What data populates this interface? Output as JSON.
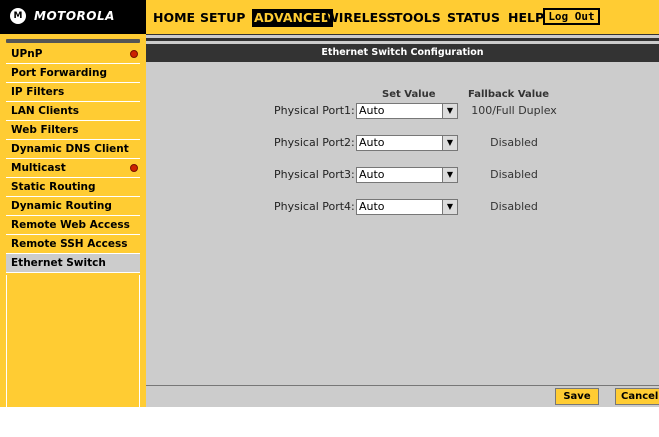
{
  "brand": {
    "logo_text": "MOTOROLA",
    "logo_badge": "M"
  },
  "nav": {
    "items": [
      {
        "label": "HOME",
        "active": false
      },
      {
        "label": "SETUP",
        "active": false
      },
      {
        "label": "ADVANCED",
        "active": true
      },
      {
        "label": "WIRELESS",
        "active": false
      },
      {
        "label": "TOOLS",
        "active": false
      },
      {
        "label": "STATUS",
        "active": false
      },
      {
        "label": "HELP",
        "active": false
      }
    ],
    "logout_label": "Log Out"
  },
  "sidebar": {
    "items": [
      {
        "label": "UPnP",
        "alert": true,
        "active": false
      },
      {
        "label": "Port Forwarding",
        "alert": false,
        "active": false
      },
      {
        "label": "IP Filters",
        "alert": false,
        "active": false
      },
      {
        "label": "LAN Clients",
        "alert": false,
        "active": false
      },
      {
        "label": "Web Filters",
        "alert": false,
        "active": false
      },
      {
        "label": "Dynamic DNS Client",
        "alert": false,
        "active": false
      },
      {
        "label": "Multicast",
        "alert": true,
        "active": false
      },
      {
        "label": "Static Routing",
        "alert": false,
        "active": false
      },
      {
        "label": "Dynamic Routing",
        "alert": false,
        "active": false
      },
      {
        "label": "Remote Web Access",
        "alert": false,
        "active": false
      },
      {
        "label": "Remote SSH Access",
        "alert": false,
        "active": false
      },
      {
        "label": "Ethernet Switch",
        "alert": false,
        "active": true
      }
    ]
  },
  "main": {
    "title": "Ethernet Switch Configuration",
    "col_set": "Set Value",
    "col_fallback": "Fallback Value",
    "ports": [
      {
        "label": "Physical Port1:",
        "value": "Auto",
        "fallback": "100/Full Duplex"
      },
      {
        "label": "Physical Port2:",
        "value": "Auto",
        "fallback": "Disabled"
      },
      {
        "label": "Physical Port3:",
        "value": "Auto",
        "fallback": "Disabled"
      },
      {
        "label": "Physical Port4:",
        "value": "Auto",
        "fallback": "Disabled"
      }
    ],
    "save_label": "Save",
    "cancel_label": "Cancel"
  },
  "colors": {
    "accent": "#ffcc33",
    "dark": "#333333",
    "panel": "#cccccc",
    "alert": "#cc2200"
  }
}
